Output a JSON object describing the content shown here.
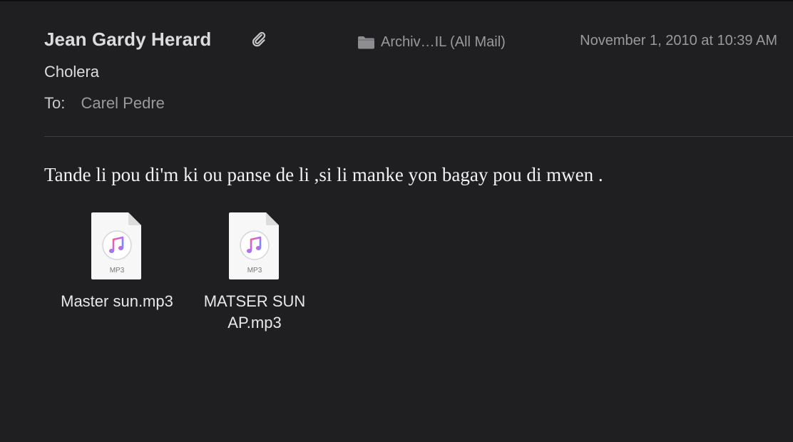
{
  "message": {
    "sender": "Jean Gardy Herard",
    "mailbox": "Archiv…IL (All Mail)",
    "date": "November 1, 2010 at 10:39 AM",
    "subject": "Cholera",
    "to_label": "To:",
    "to_value": "Carel Pedre",
    "body": "Tande li pou di'm ki ou panse de li ,si li manke yon bagay pou di mwen ."
  },
  "attachments": [
    {
      "icon": "mp3-file-icon",
      "badge": "MP3",
      "name": "Master sun.mp3"
    },
    {
      "icon": "mp3-file-icon",
      "badge": "MP3",
      "name": "MATSER SUN AP.mp3"
    }
  ],
  "colors": {
    "background": "#1f1f21",
    "primary_text": "#dcdcde",
    "secondary_text": "#9a9a9e",
    "divider": "#3f3f42"
  }
}
